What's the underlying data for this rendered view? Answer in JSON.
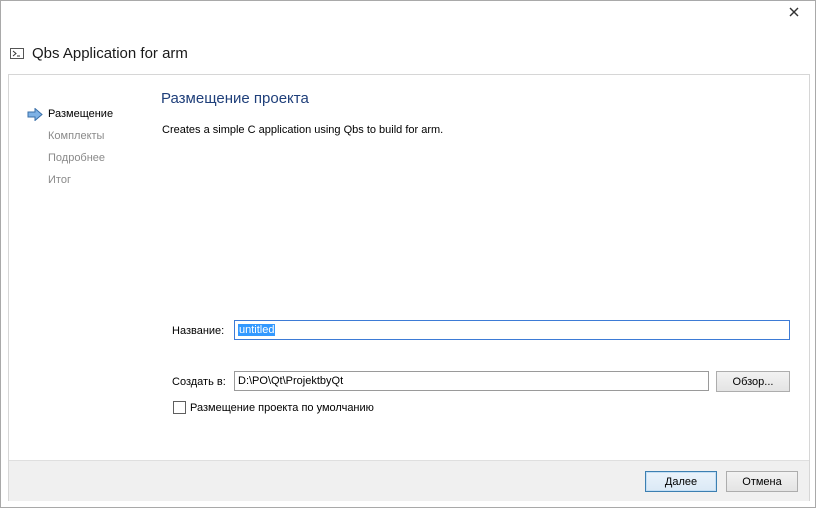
{
  "window": {
    "title": "Qbs Application for arm",
    "close_symbol": "✕"
  },
  "sidebar": {
    "steps": [
      {
        "label": "Размещение",
        "active": true
      },
      {
        "label": "Комплекты",
        "active": false
      },
      {
        "label": "Подробнее",
        "active": false
      },
      {
        "label": "Итог",
        "active": false
      }
    ]
  },
  "main": {
    "page_title": "Размещение проекта",
    "description": "Creates a simple C application using Qbs to build for arm.",
    "name_label": "Название:",
    "name_value": "untitled",
    "location_label": "Создать в:",
    "location_value": "D:\\PO\\Qt\\ProjektbyQt",
    "browse_label": "Обзор...",
    "default_location_label": "Размещение проекта по умолчанию",
    "default_location_checked": false
  },
  "footer": {
    "next_label": "Далее",
    "cancel_label": "Отмена"
  },
  "colors": {
    "accent": "#1f3f7a",
    "selection": "#3399ff",
    "arrow": "#4a86c9"
  },
  "icons": {
    "close": "close-icon",
    "app": "terminal-app-icon",
    "current_step": "right-arrow-icon"
  }
}
